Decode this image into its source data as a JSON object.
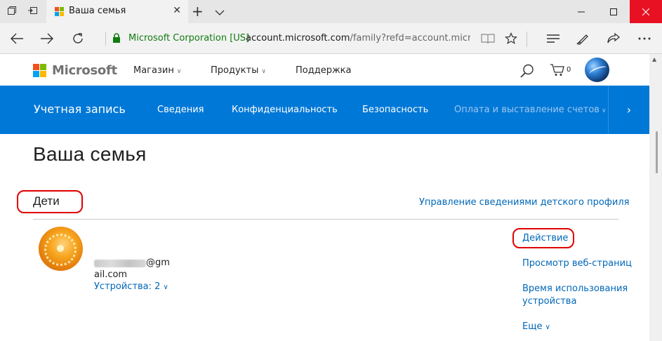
{
  "browser": {
    "tab_title": "Ваша семья",
    "cert_label": "Microsoft Corporation [US]",
    "url_host": "account.microsoft.com",
    "url_rest": "/family?refd=account.microsoft.c"
  },
  "header": {
    "brand": "Microsoft",
    "nav": [
      {
        "label": "Магазин",
        "chevron": "∨"
      },
      {
        "label": "Продукты",
        "chevron": "∨"
      },
      {
        "label": "Поддержка",
        "chevron": ""
      }
    ],
    "cart_count": "0"
  },
  "account_nav": {
    "title": "Учетная запись",
    "links": [
      "Сведения",
      "Конфиденциальность",
      "Безопасность"
    ],
    "dim_link": "Оплата и выставление счетов",
    "dim_chevron": "∨",
    "more_glyph": "›"
  },
  "page": {
    "title": "Ваша семья",
    "section_title": "Дети",
    "manage_link": "Управление сведениями детского профиля"
  },
  "child": {
    "email_tail": "@gm",
    "email_line2": "ail.com",
    "devices_label": "Устройства: 2",
    "devices_chevron": "∨",
    "actions": [
      {
        "label": "Действие"
      },
      {
        "label": "Просмотр веб-страниц"
      },
      {
        "label": "Время использования"
      },
      {
        "label": "устройства"
      },
      {
        "label": "Еще"
      }
    ],
    "more_chevron": "∨"
  },
  "colors": {
    "accent_blue": "#0078d7",
    "link_blue": "#0067b8",
    "highlight_red": "#e00000",
    "cert_green": "#107c10"
  }
}
